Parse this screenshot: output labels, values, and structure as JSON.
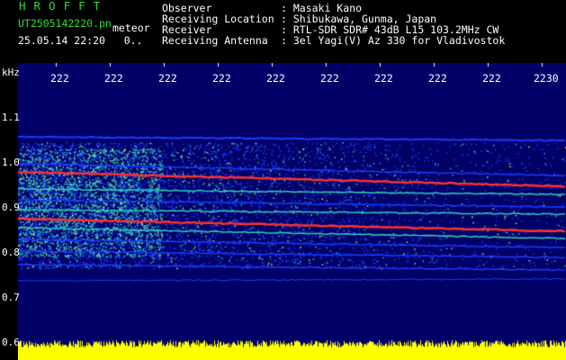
{
  "header": {
    "brand": "HROFFT",
    "filename": "UT2505142220.pn",
    "tag": "meteor",
    "timestamp": "25.05.14 22:20   0..",
    "info": [
      {
        "label": "Observer",
        "value": ": Masaki Kano"
      },
      {
        "label": "Receiving Location",
        "value": ": Shibukawa, Gunma, Japan"
      },
      {
        "label": "Receiver",
        "value": ": RTL-SDR SDR# 43dB L15 103.2MHz CW"
      },
      {
        "label": "Receiving Antenna",
        "value": ": 3el Yagi(V) Az 330 for Vladivostok"
      }
    ]
  },
  "spectrogram": {
    "unit": "kHz",
    "x_ticks": [
      "222",
      "222",
      "222",
      "222",
      "222",
      "222",
      "222",
      "222",
      "222",
      "2230"
    ],
    "y_ticks": [
      "1.1",
      "1.0",
      "0.9",
      "0.8",
      "0.7",
      "0.6"
    ],
    "colors": {
      "background": "#000066",
      "signal_low": "#1a3cff",
      "signal_mid": "#2ad0c0",
      "signal_high": "#ff3030",
      "noise": "#ffff00"
    }
  }
}
